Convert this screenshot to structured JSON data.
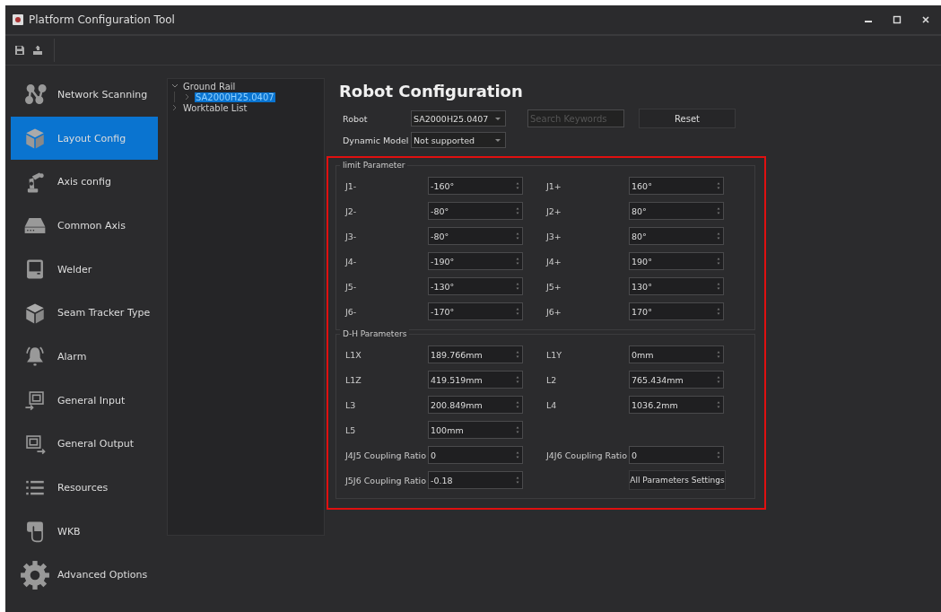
{
  "window": {
    "title": "Platform Configuration Tool"
  },
  "sidebar": {
    "items": [
      {
        "label": "Network Scanning",
        "selected": false
      },
      {
        "label": "Layout Config",
        "selected": true
      },
      {
        "label": "Axis config",
        "selected": false
      },
      {
        "label": "Common Axis",
        "selected": false
      },
      {
        "label": "Welder",
        "selected": false
      },
      {
        "label": "Seam Tracker Type",
        "selected": false
      },
      {
        "label": "Alarm",
        "selected": false
      },
      {
        "label": "General Input",
        "selected": false
      },
      {
        "label": "General Output",
        "selected": false
      },
      {
        "label": "Resources",
        "selected": false
      },
      {
        "label": "WKB",
        "selected": false
      },
      {
        "label": "Advanced Options",
        "selected": false
      }
    ]
  },
  "tree": [
    {
      "label": "Ground Rail",
      "expanded": true,
      "selected": false,
      "children": [
        {
          "label": "SA2000H25.0407",
          "expanded": false,
          "selected": true
        }
      ]
    },
    {
      "label": "Worktable List",
      "expanded": false,
      "selected": false
    }
  ],
  "main": {
    "title": "Robot Configuration",
    "robot": {
      "label": "Robot",
      "value": "SA2000H25.0407"
    },
    "dynamic_model": {
      "label": "Dynamic Model",
      "value": "Not supported"
    },
    "search": {
      "placeholder": "Search Keywords"
    },
    "reset_button": "Reset",
    "limit_group": {
      "title": "limit Parameter",
      "rows": [
        [
          {
            "kind": "field",
            "label": "J1-",
            "value": "-160°"
          },
          {
            "kind": "field",
            "label": "J1+",
            "value": "160°"
          }
        ],
        [
          {
            "kind": "field",
            "label": "J2-",
            "value": "-80°"
          },
          {
            "kind": "field",
            "label": "J2+",
            "value": "80°"
          }
        ],
        [
          {
            "kind": "field",
            "label": "J3-",
            "value": "-80°"
          },
          {
            "kind": "field",
            "label": "J3+",
            "value": "80°"
          }
        ],
        [
          {
            "kind": "field",
            "label": "J4-",
            "value": "-190°"
          },
          {
            "kind": "field",
            "label": "J4+",
            "value": "190°"
          }
        ],
        [
          {
            "kind": "field",
            "label": "J5-",
            "value": "-130°"
          },
          {
            "kind": "field",
            "label": "J5+",
            "value": "130°"
          }
        ],
        [
          {
            "kind": "field",
            "label": "J6-",
            "value": "-170°"
          },
          {
            "kind": "field",
            "label": "J6+",
            "value": "170°"
          }
        ]
      ]
    },
    "dh_group": {
      "title": "D-H Parameters",
      "rows": [
        [
          {
            "kind": "field",
            "label": "L1X",
            "value": "189.766mm"
          },
          {
            "kind": "field",
            "label": "L1Y",
            "value": "0mm"
          }
        ],
        [
          {
            "kind": "field",
            "label": "L1Z",
            "value": "419.519mm"
          },
          {
            "kind": "field",
            "label": "L2",
            "value": "765.434mm"
          }
        ],
        [
          {
            "kind": "field",
            "label": "L3",
            "value": "200.849mm"
          },
          {
            "kind": "field",
            "label": "L4",
            "value": "1036.2mm"
          }
        ],
        [
          {
            "kind": "field",
            "label": "L5",
            "value": "100mm"
          }
        ],
        [
          {
            "kind": "field",
            "label": "J4J5 Coupling Ratio",
            "value": "0"
          },
          {
            "kind": "field",
            "label": "J4J6 Coupling Ratio",
            "value": "0"
          }
        ],
        [
          {
            "kind": "field",
            "label": "J5J6 Coupling Ratio",
            "value": "-0.18"
          },
          {
            "kind": "button",
            "label": "All Parameters Settings"
          }
        ]
      ]
    }
  }
}
